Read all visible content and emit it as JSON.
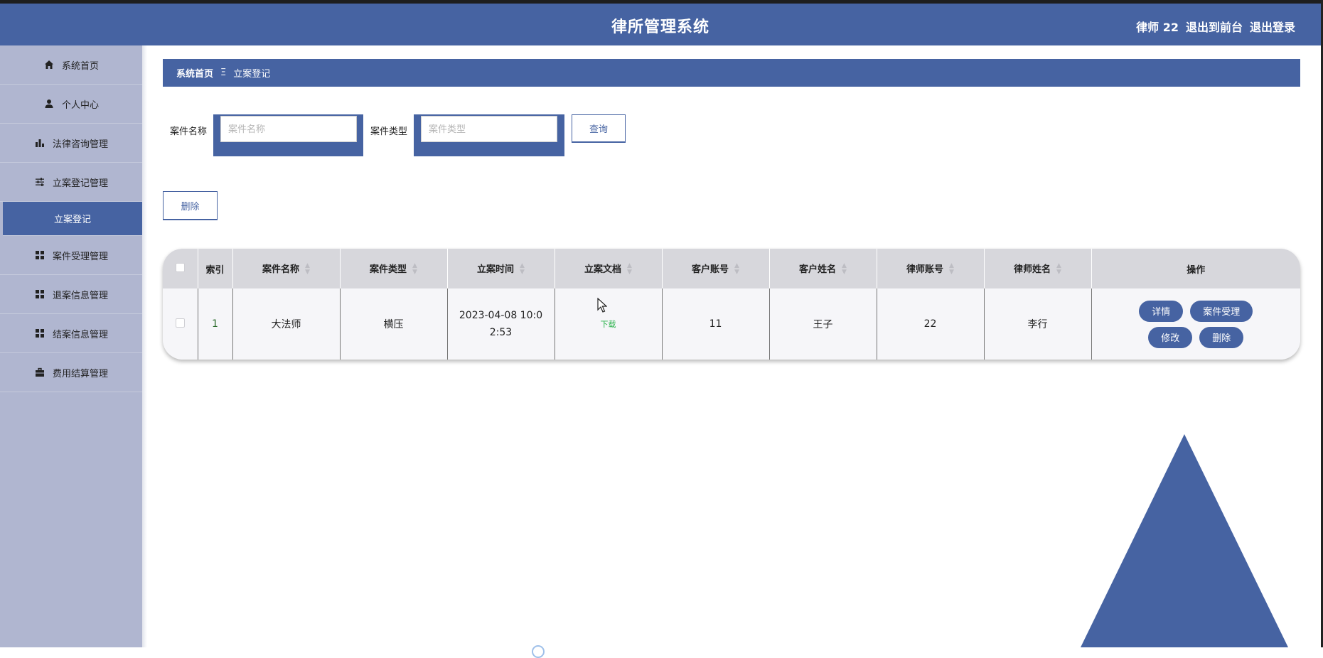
{
  "header": {
    "title": "律所管理系统",
    "user": "律师 22",
    "to_front": "退出到前台",
    "logout": "退出登录"
  },
  "sidebar": {
    "items": [
      {
        "label": "系统首页",
        "icon": "home-icon"
      },
      {
        "label": "个人中心",
        "icon": "user-icon"
      },
      {
        "label": "法律咨询管理",
        "icon": "bar-chart-icon"
      },
      {
        "label": "立案登记管理",
        "icon": "sliders-icon"
      },
      {
        "label": "案件受理管理",
        "icon": "grid-icon"
      },
      {
        "label": "退案信息管理",
        "icon": "grid-icon"
      },
      {
        "label": "结案信息管理",
        "icon": "grid-icon"
      },
      {
        "label": "费用结算管理",
        "icon": "briefcase-icon"
      }
    ],
    "active_sub": "立案登记"
  },
  "breadcrumb": {
    "home": "系统首页",
    "sep": "Ξ",
    "current": "立案登记"
  },
  "search": {
    "name_label": "案件名称",
    "name_placeholder": "案件名称",
    "type_label": "案件类型",
    "type_placeholder": "案件类型",
    "query_button": "查询"
  },
  "toolbar": {
    "delete_button": "删除"
  },
  "table": {
    "columns": [
      "索引",
      "案件名称",
      "案件类型",
      "立案时间",
      "立案文档",
      "客户账号",
      "客户姓名",
      "律师账号",
      "律师姓名",
      "操作"
    ],
    "rows": [
      {
        "index": "1",
        "case_name": "大法师",
        "case_type": "横压",
        "filing_time": "2023-04-08 10:02:53",
        "document": "下载",
        "client_account": "11",
        "client_name": "王子",
        "lawyer_account": "22",
        "lawyer_name": "李行",
        "actions": {
          "detail": "详情",
          "accept": "案件受理",
          "edit": "修改",
          "delete": "删除"
        }
      }
    ]
  },
  "colors": {
    "primary": "#4663a2",
    "sidebar_bg": "#b0b6d0",
    "table_header": "#d7d7dc",
    "download": "#2bb24c"
  }
}
